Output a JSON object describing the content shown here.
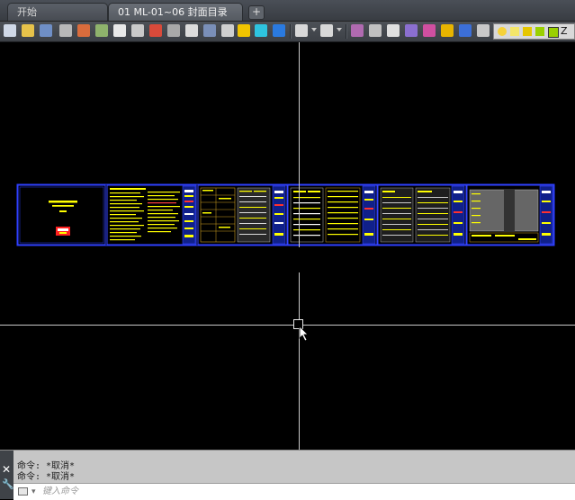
{
  "tabs": {
    "start_label": "开始",
    "doc_label": "01  ML-01~06 封面目录",
    "add_label": "+"
  },
  "toolbar": {
    "icons": [
      "new-icon",
      "open-icon",
      "save-icon",
      "print-icon",
      "plot-icon",
      "publish-icon",
      "render-icon",
      "cut-icon",
      "copy-icon",
      "paste-icon",
      "match-prop-icon",
      "block-icon",
      "insert-icon",
      "text-icon",
      "table-icon",
      "hatch-icon",
      "undo-icon",
      "redo-icon",
      "erase-icon",
      "properties-icon",
      "layer-icon",
      "pan-icon",
      "zoom-icon",
      "measure-icon",
      "gradient-icon",
      "view-icon",
      "3d-icon"
    ],
    "layer_name": "Z"
  },
  "command": {
    "history": [
      "命令: *取消*",
      "命令: *取消*"
    ],
    "placeholder": "键入命令"
  },
  "colors": {
    "background": "#000000",
    "crosshair": "#c9c9c9",
    "sheet_border": "#2a3bff",
    "text_yellow": "#ffff00",
    "text_red": "#ff2020"
  },
  "drawing": {
    "sheet_count": 10,
    "content": "CAD title sheets laid out in a row (cover + drawing index pages)"
  }
}
